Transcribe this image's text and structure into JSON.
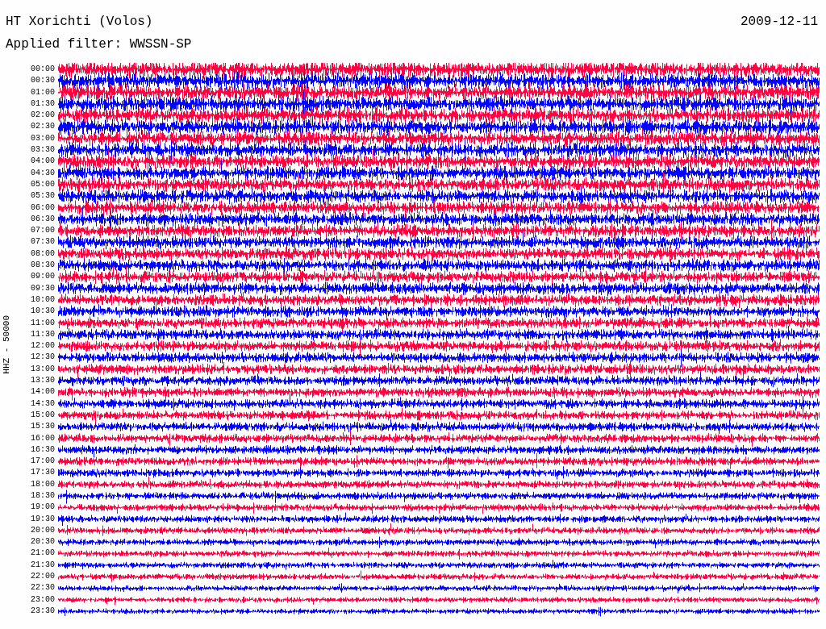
{
  "header": {
    "station": "HT Xorichti (Volos)",
    "date": "2009-12-11",
    "filter": "Applied filter: WWSSN-SP"
  },
  "axis_label": "HHZ - 50000",
  "rows": [
    {
      "time": "00:00",
      "color": "#ff0040"
    },
    {
      "time": "00:30",
      "color": "#0000ff"
    },
    {
      "time": "01:00",
      "color": "#ff0040"
    },
    {
      "time": "01:30",
      "color": "#0000ff"
    },
    {
      "time": "02:00",
      "color": "#ff0040"
    },
    {
      "time": "02:30",
      "color": "#0000ff"
    },
    {
      "time": "03:00",
      "color": "#ff0040"
    },
    {
      "time": "03:30",
      "color": "#0000ff"
    },
    {
      "time": "04:00",
      "color": "#ff0040"
    },
    {
      "time": "04:30",
      "color": "#0000ff"
    },
    {
      "time": "05:00",
      "color": "#ff0040"
    },
    {
      "time": "05:30",
      "color": "#0000ff"
    },
    {
      "time": "06:00",
      "color": "#ff0040"
    },
    {
      "time": "06:30",
      "color": "#0000ff"
    },
    {
      "time": "07:00",
      "color": "#ff0040"
    },
    {
      "time": "07:30",
      "color": "#0000ff"
    },
    {
      "time": "08:00",
      "color": "#ff0040"
    },
    {
      "time": "08:30",
      "color": "#0000ff"
    },
    {
      "time": "09:00",
      "color": "#ff0040"
    },
    {
      "time": "09:30",
      "color": "#0000ff"
    },
    {
      "time": "10:00",
      "color": "#ff0040"
    },
    {
      "time": "10:30",
      "color": "#0000ff"
    },
    {
      "time": "11:00",
      "color": "#ff0040"
    },
    {
      "time": "11:30",
      "color": "#0000ff"
    },
    {
      "time": "12:00",
      "color": "#ff0040"
    },
    {
      "time": "12:30",
      "color": "#0000ff"
    },
    {
      "time": "13:00",
      "color": "#ff0040"
    },
    {
      "time": "13:30",
      "color": "#0000ff"
    },
    {
      "time": "14:00",
      "color": "#ff0040"
    },
    {
      "time": "14:30",
      "color": "#0000ff"
    },
    {
      "time": "15:00",
      "color": "#ff0040"
    },
    {
      "time": "15:30",
      "color": "#0000ff"
    },
    {
      "time": "16:00",
      "color": "#ff0040"
    },
    {
      "time": "16:30",
      "color": "#0000ff"
    },
    {
      "time": "17:00",
      "color": "#ff0040"
    },
    {
      "time": "17:30",
      "color": "#0000ff"
    },
    {
      "time": "18:00",
      "color": "#ff0040"
    },
    {
      "time": "18:30",
      "color": "#0000ff"
    },
    {
      "time": "19:00",
      "color": "#ff0040"
    },
    {
      "time": "19:30",
      "color": "#0000ff"
    },
    {
      "time": "20:00",
      "color": "#ff0040"
    },
    {
      "time": "20:30",
      "color": "#0000ff"
    },
    {
      "time": "21:00",
      "color": "#ff0040"
    },
    {
      "time": "21:30",
      "color": "#0000ff"
    },
    {
      "time": "22:00",
      "color": "#ff0040"
    },
    {
      "time": "22:30",
      "color": "#0000ff"
    },
    {
      "time": "23:00",
      "color": "#ff0040"
    },
    {
      "time": "23:30",
      "color": "#0000ff"
    }
  ]
}
